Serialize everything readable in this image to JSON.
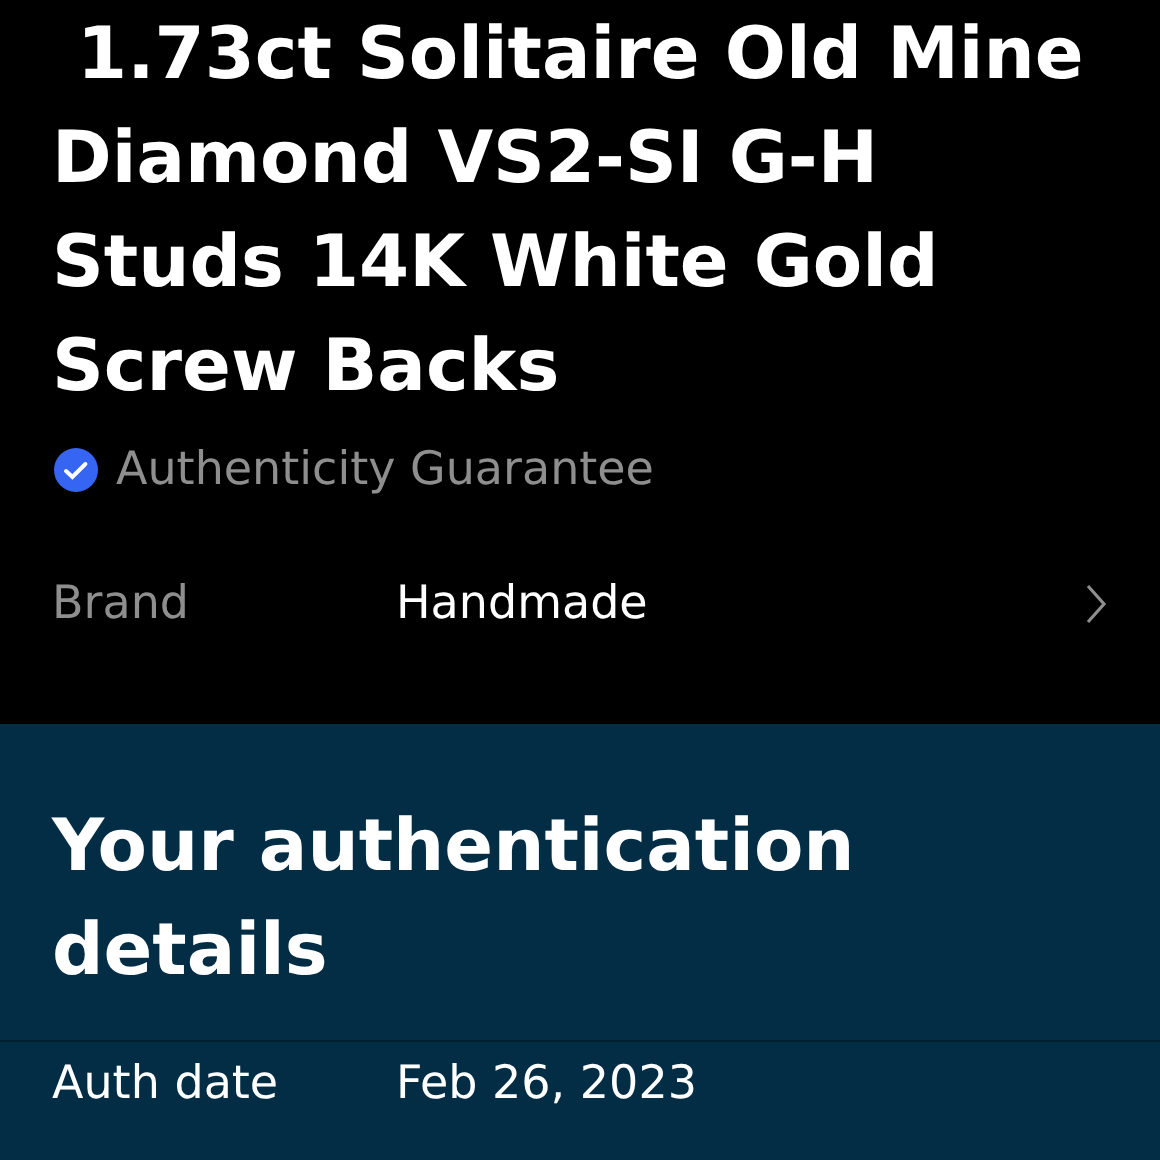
{
  "listing": {
    "title": " 1.73ct Solitaire Old Mine Diamond VS2-SI G-H Studs 14K White Gold Screw Backs",
    "badge": "Authenticity Guarantee",
    "specifics": [
      {
        "label": "Brand",
        "value": "Handmade"
      }
    ]
  },
  "authentication": {
    "heading": "Your authentication details",
    "rows": [
      {
        "label": "Auth date",
        "value": "Feb 26, 2023"
      }
    ]
  }
}
